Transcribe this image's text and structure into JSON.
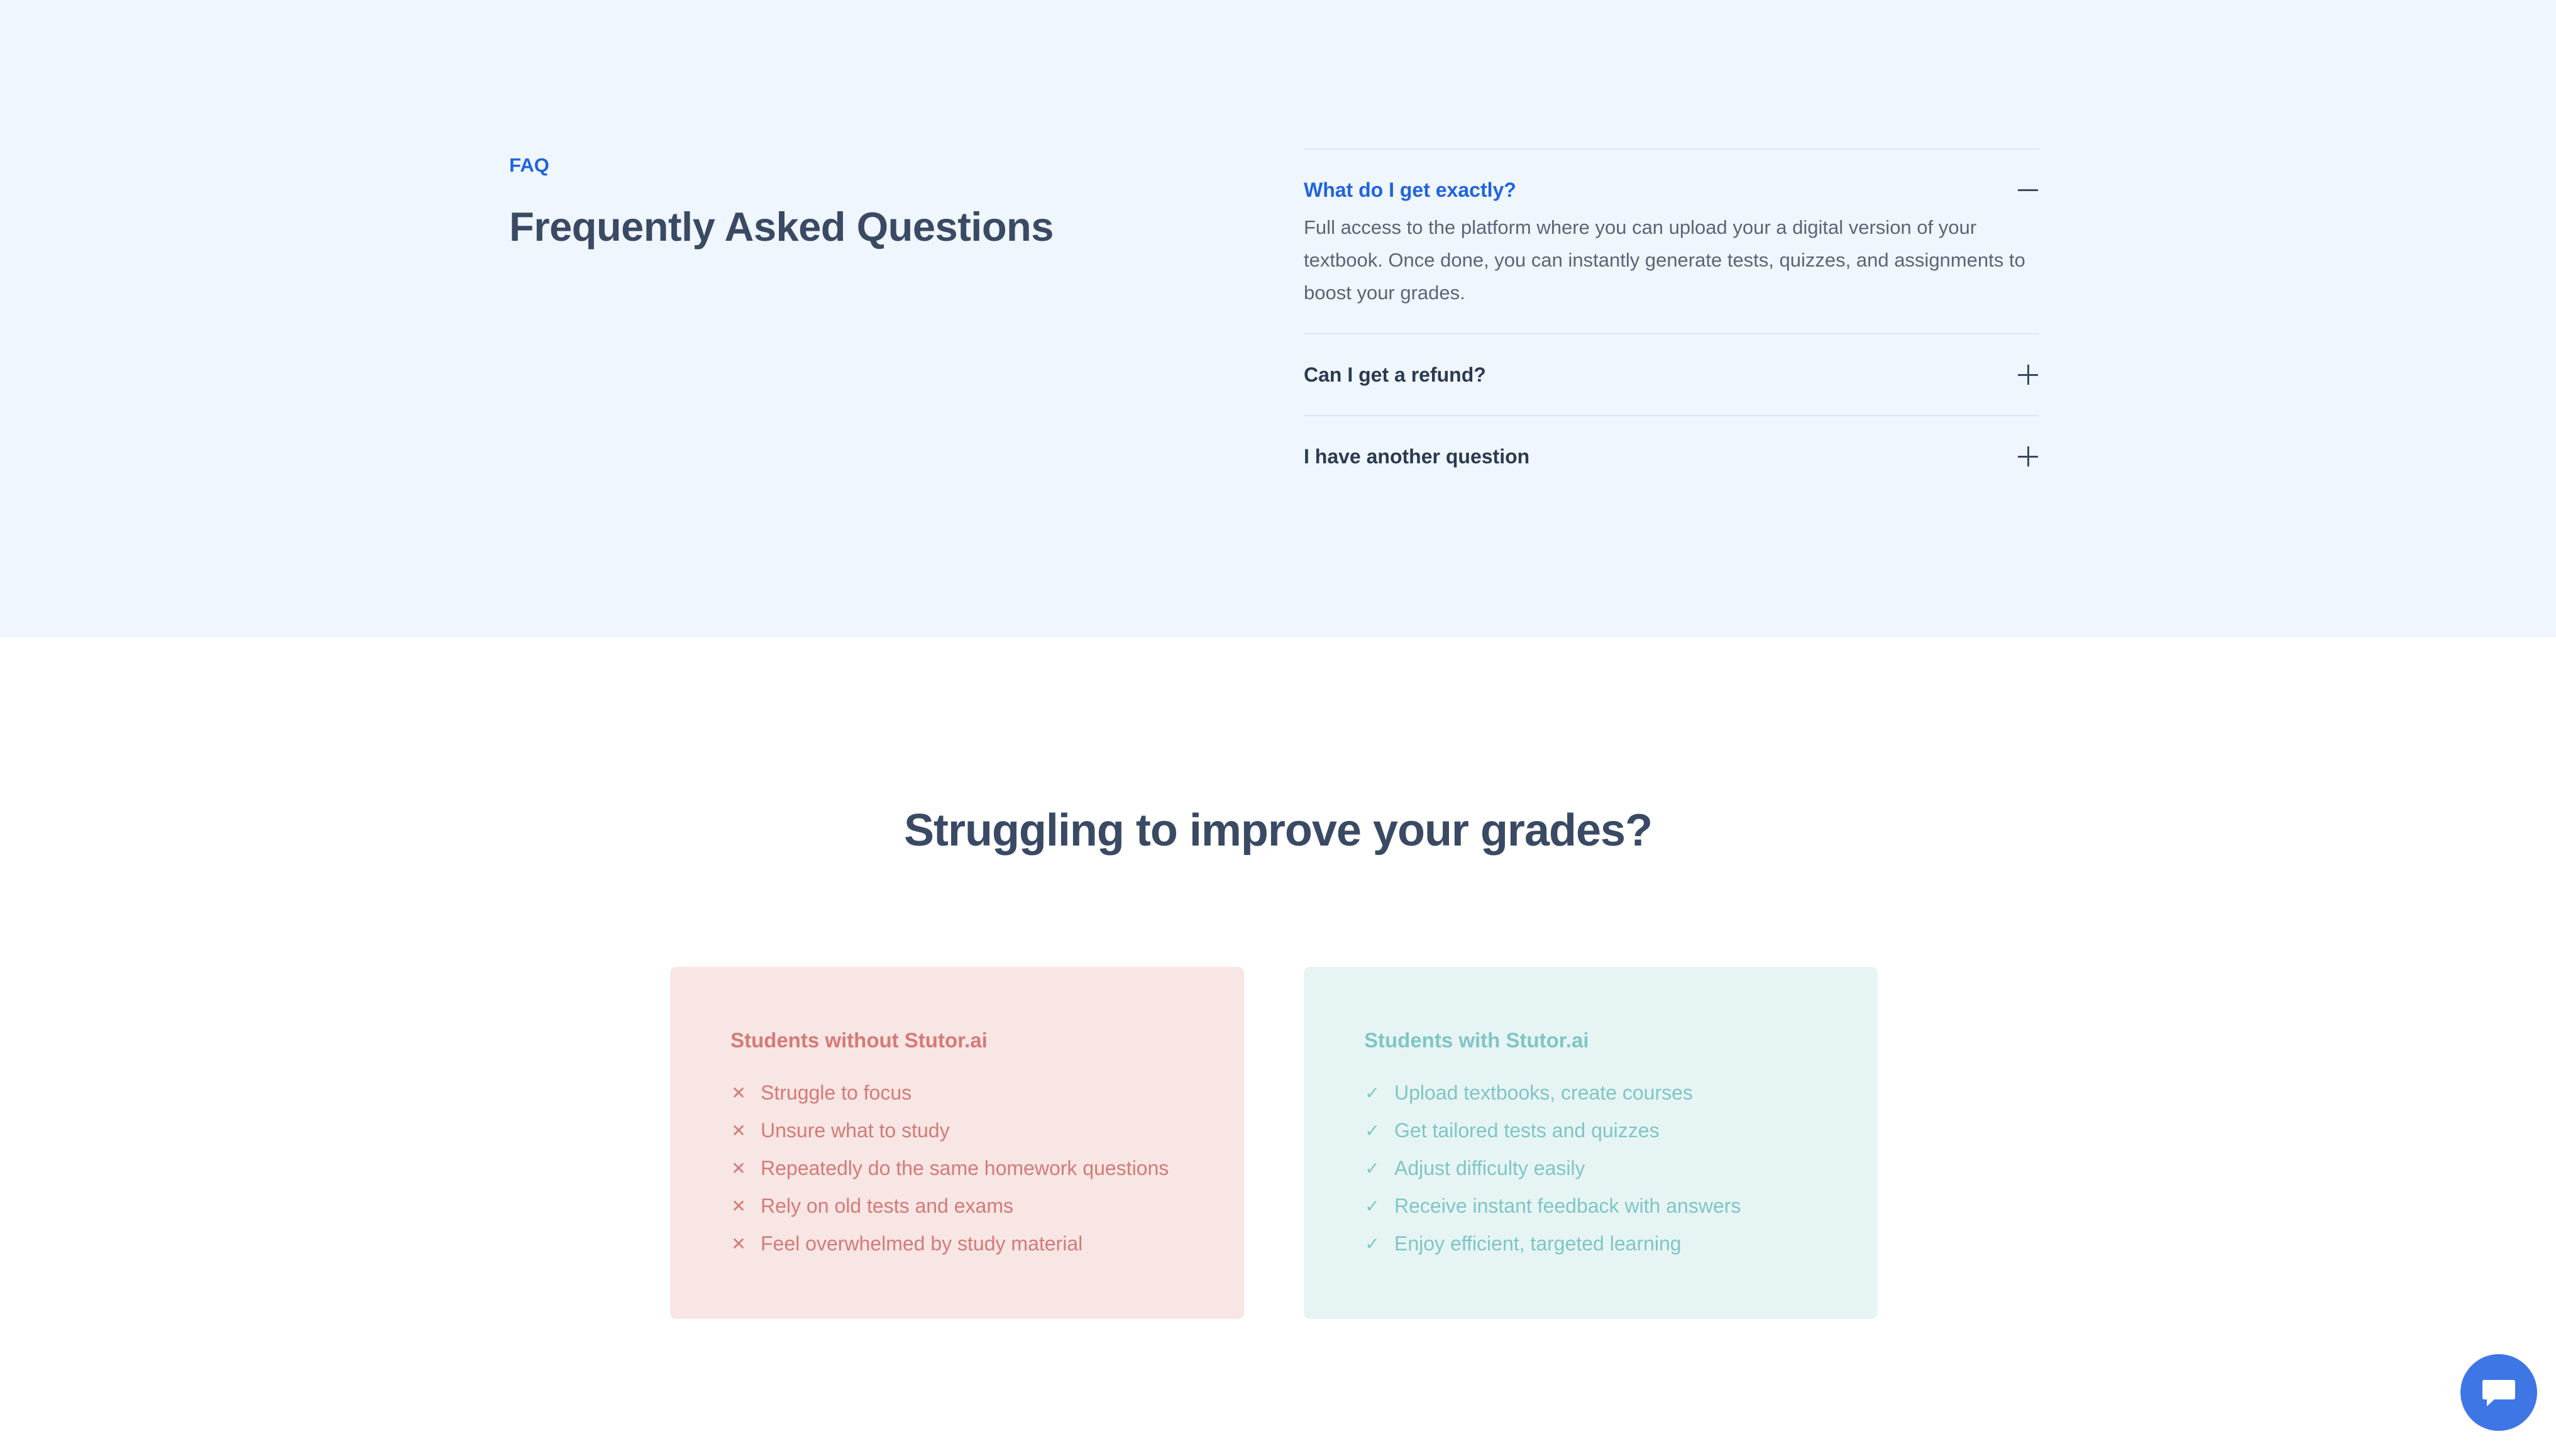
{
  "faq": {
    "label": "FAQ",
    "title": "Frequently Asked Questions",
    "items": [
      {
        "question": "What do I get exactly?",
        "answer": "Full access to the platform where you can upload your a digital version of your textbook. Once done, you can instantly generate tests, quizzes, and assignments to boost your grades.",
        "expanded": true
      },
      {
        "question": "Can I get a refund?",
        "expanded": false
      },
      {
        "question": "I have another question",
        "expanded": false
      }
    ]
  },
  "comparison": {
    "title": "Struggling to improve your grades?",
    "without": {
      "heading": "Students without Stutor.ai",
      "icon": "x-icon",
      "items": [
        "Struggle to focus",
        "Unsure what to study",
        "Repeatedly do the same homework questions",
        "Rely on old tests and exams",
        "Feel overwhelmed by study material"
      ]
    },
    "with": {
      "heading": "Students with Stutor.ai",
      "icon": "check-icon",
      "items": [
        "Upload textbooks, create courses",
        "Get tailored tests and quizzes",
        "Adjust difficulty easily",
        "Receive instant feedback with answers",
        "Enjoy efficient, targeted learning"
      ]
    }
  },
  "chat": {
    "icon": "chat-bubble-icon"
  },
  "colors": {
    "accent": "#1f63e0",
    "faq_background": "#f0f6fe",
    "negative": "#d57a78",
    "positive": "#7ec6c4"
  }
}
